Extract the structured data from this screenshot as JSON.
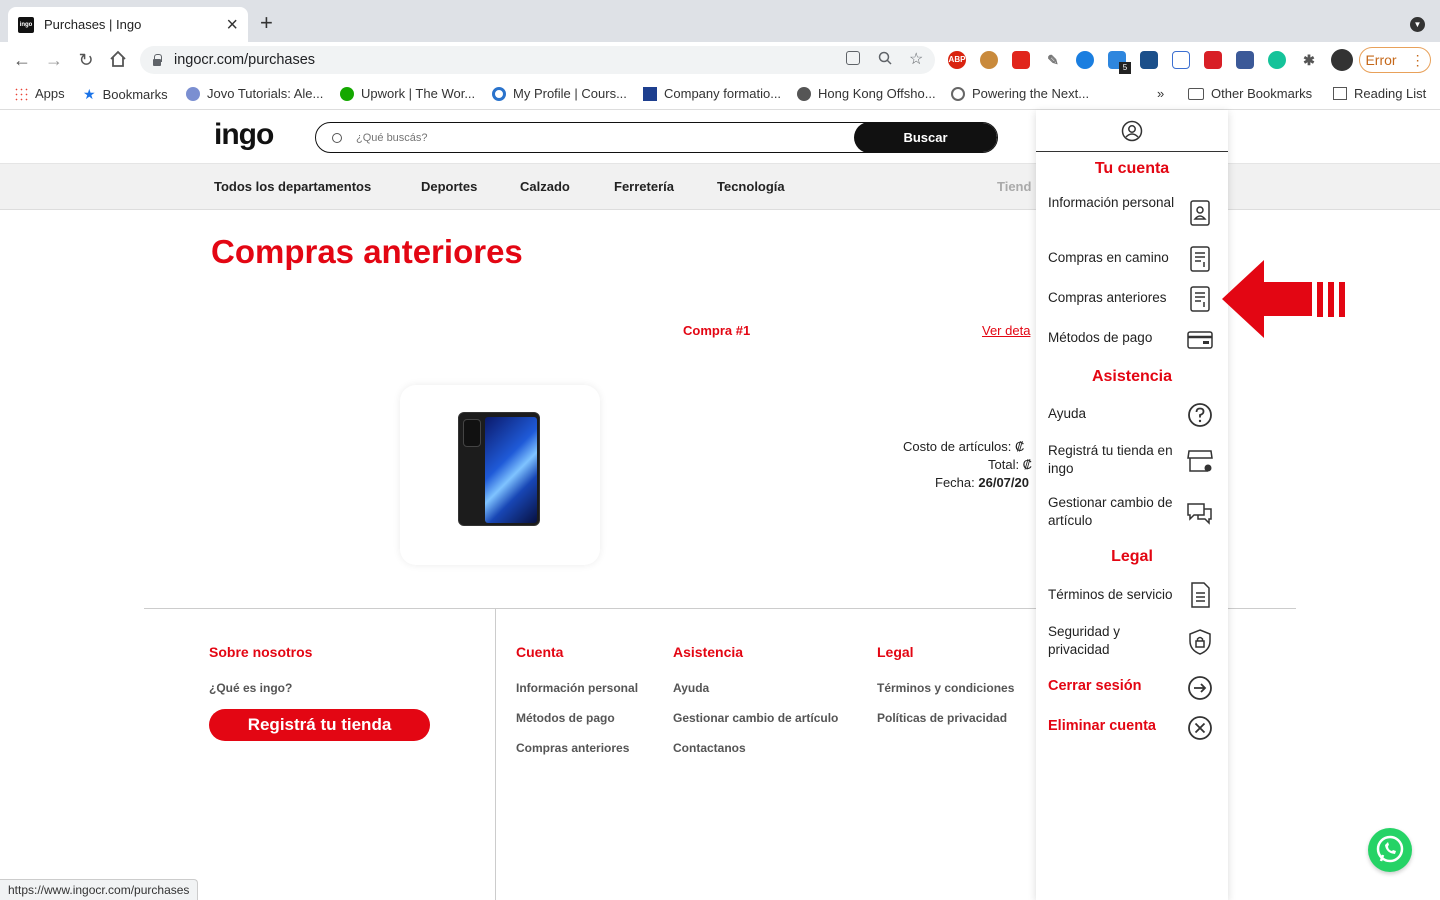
{
  "browser": {
    "tab_title": "Purchases | Ingo",
    "tab_favicon": "ingo",
    "url": "ingocr.com/purchases",
    "error_label": "Error",
    "status_url": "https://www.ingocr.com/purchases",
    "ext_abp": "ABP",
    "ext_badge": "5",
    "bookmarks": [
      "Apps",
      "Bookmarks",
      "Jovo Tutorials: Ale...",
      "Upwork | The Wor...",
      "My Profile | Cours...",
      "Company formatio...",
      "Hong Kong Offsho...",
      "Powering the Next..."
    ],
    "more_bookmarks": "»",
    "other_bookmarks": "Other Bookmarks",
    "reading_list": "Reading List",
    "icons": [
      "back-icon",
      "forward-icon",
      "reload-icon",
      "home-icon",
      "lock-icon",
      "zoom-icon",
      "star-icon",
      "extensions-icon"
    ]
  },
  "site": {
    "logo": "ingo",
    "search_placeholder": "¿Qué buscás?",
    "search_button": "Buscar",
    "categories": [
      "Todos los departamentos",
      "Deportes",
      "Calzado",
      "Ferretería",
      "Tecnología"
    ],
    "stores_label": "Tiend",
    "accent_color": "#e30613"
  },
  "main": {
    "title": "Compras anteriores",
    "order": {
      "number": "Compra #1",
      "details_link": "Ver deta",
      "cost_label": "Costo de artículos: ₡",
      "total_label": "Total: ₡",
      "date_label": "Fecha:",
      "date_value": "26/07/20"
    }
  },
  "footer": {
    "about": {
      "heading": "Sobre nosotros",
      "what_is": "¿Qué es ingo?",
      "register": "Registrá tu tienda"
    },
    "account": {
      "heading": "Cuenta",
      "links": [
        "Información personal",
        "Métodos de pago",
        "Compras anteriores"
      ]
    },
    "help": {
      "heading": "Asistencia",
      "links": [
        "Ayuda",
        "Gestionar cambio de artículo",
        "Contactanos"
      ]
    },
    "legal": {
      "heading": "Legal",
      "links": [
        "Términos y condiciones",
        "Políticas de privacidad"
      ]
    }
  },
  "dropdown": {
    "account_heading": "Tu cuenta",
    "personal_info": "Información personal",
    "orders_in_transit": "Compras en camino",
    "past_orders": "Compras anteriores",
    "payment_methods": "Métodos de pago",
    "help_heading": "Asistencia",
    "help": "Ayuda",
    "register_store": "Registrá tu tienda en ingo",
    "manage_exchange": "Gestionar cambio de artículo",
    "legal_heading": "Legal",
    "terms": "Términos de servicio",
    "security": "Seguridad y privacidad",
    "logout": "Cerrar sesión",
    "delete_account": "Eliminar cuenta"
  }
}
